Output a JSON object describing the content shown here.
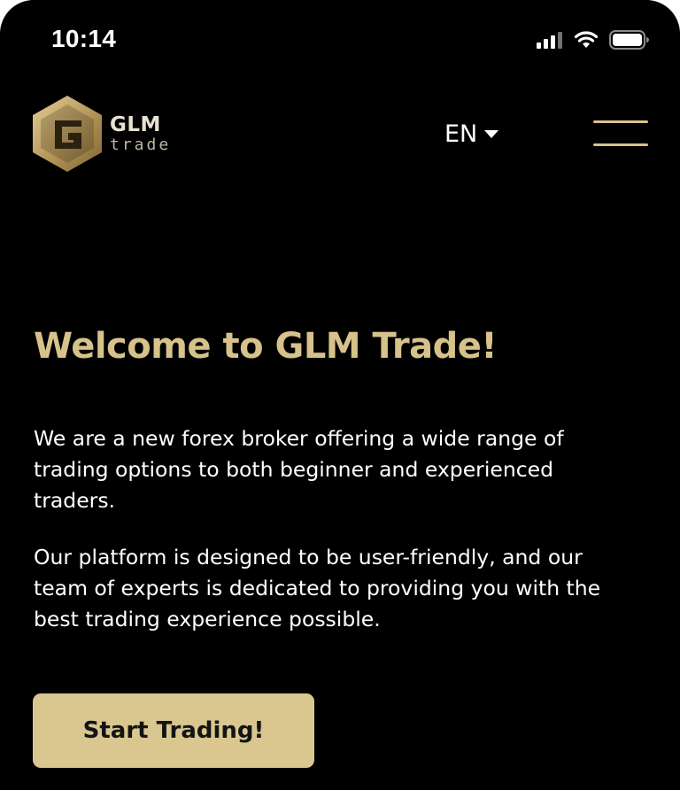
{
  "status_bar": {
    "time": "10:14",
    "icons": [
      "cellular-signal-icon",
      "wifi-icon",
      "battery-icon"
    ]
  },
  "header": {
    "logo": {
      "mark_letter": "G",
      "brand": "GLM",
      "sub": "trade"
    },
    "language": {
      "selected": "EN",
      "icon": "chevron-down-icon"
    },
    "menu": {
      "icon": "hamburger-menu-icon"
    }
  },
  "hero": {
    "title": "Welcome to GLM Trade!",
    "paragraphs": [
      "We are a new forex broker offering a wide range of trading options to both beginner and experienced traders.",
      "Our platform is designed to be user-friendly, and our team of experts is dedicated to providing you with the best trading experience possible."
    ],
    "cta_label": "Start Trading!"
  },
  "colors": {
    "background": "#000000",
    "accent_gold": "#d6c28a",
    "button_gold": "#d9c78f",
    "text": "#ffffff"
  }
}
